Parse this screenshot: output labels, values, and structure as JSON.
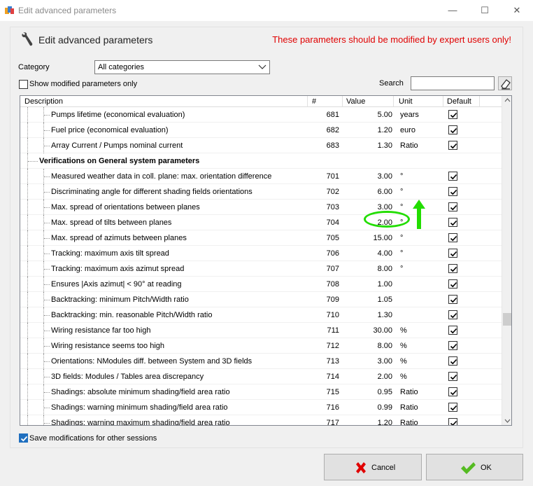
{
  "window": {
    "title": "Edit advanced parameters",
    "minimize_glyph": "—",
    "maximize_glyph": "☐",
    "close_glyph": "✕"
  },
  "header": {
    "title": "Edit advanced parameters",
    "warning": "These parameters should be modified by expert users only!",
    "warning_color": "#e00000",
    "icon": "wrench-icon"
  },
  "filters": {
    "category_label": "Category",
    "category_value": "All categories",
    "show_modified_label": "Show modified parameters only",
    "show_modified_checked": false,
    "search_label": "Search",
    "search_value": ""
  },
  "table": {
    "columns": [
      "Description",
      "#",
      "Value",
      "Unit",
      "Default"
    ],
    "rows": [
      {
        "type": "item",
        "desc": "Pumps lifetime (economical evaluation)",
        "num": "681",
        "value": "5.00",
        "unit": "years",
        "default": true
      },
      {
        "type": "item",
        "desc": "Fuel price (economical evaluation)",
        "num": "682",
        "value": "1.20",
        "unit": "euro",
        "default": true
      },
      {
        "type": "item",
        "desc": "Array Current / Pumps nominal current",
        "num": "683",
        "value": "1.30",
        "unit": "Ratio",
        "default": true
      },
      {
        "type": "group",
        "desc": "Verifications on General system parameters"
      },
      {
        "type": "item",
        "desc": "Measured weather data in coll. plane: max. orientation difference",
        "num": "701",
        "value": "3.00",
        "unit": "°",
        "default": true
      },
      {
        "type": "item",
        "desc": "Discriminating angle for different shading fields orientations",
        "num": "702",
        "value": "6.00",
        "unit": "°",
        "default": true
      },
      {
        "type": "item",
        "desc": "Max. spread of orientations between planes",
        "num": "703",
        "value": "3.00",
        "unit": "°",
        "default": true
      },
      {
        "type": "item",
        "desc": "Max. spread of tilts between planes",
        "num": "704",
        "value": "2.00",
        "unit": "°",
        "default": true
      },
      {
        "type": "item",
        "desc": "Max. spread of azimuts between planes",
        "num": "705",
        "value": "15.00",
        "unit": "°",
        "default": true
      },
      {
        "type": "item",
        "desc": "Tracking: maximum axis tilt spread",
        "num": "706",
        "value": "4.00",
        "unit": "°",
        "default": true
      },
      {
        "type": "item",
        "desc": "Tracking: maximum axis azimut spread",
        "num": "707",
        "value": "8.00",
        "unit": "°",
        "default": true
      },
      {
        "type": "item",
        "desc": "Ensures |Axis azimut| < 90° at reading",
        "num": "708",
        "value": "1.00",
        "unit": "",
        "default": true
      },
      {
        "type": "item",
        "desc": "Backtracking: minimum Pitch/Width ratio",
        "num": "709",
        "value": "1.05",
        "unit": "",
        "default": true
      },
      {
        "type": "item",
        "desc": "Backtracking: min. reasonable Pitch/Width ratio",
        "num": "710",
        "value": "1.30",
        "unit": "",
        "default": true
      },
      {
        "type": "item",
        "desc": "Wiring resistance far too high",
        "num": "711",
        "value": "30.00",
        "unit": "%",
        "default": true
      },
      {
        "type": "item",
        "desc": "Wiring resistance seems too high",
        "num": "712",
        "value": "8.00",
        "unit": "%",
        "default": true
      },
      {
        "type": "item",
        "desc": "Orientations: NModules diff. between System and 3D fields",
        "num": "713",
        "value": "3.00",
        "unit": "%",
        "default": true
      },
      {
        "type": "item",
        "desc": "3D fields: Modules / Tables area discrepancy",
        "num": "714",
        "value": "2.00",
        "unit": "%",
        "default": true
      },
      {
        "type": "item",
        "desc": "Shadings: absolute minimum shading/field area ratio",
        "num": "715",
        "value": "0.95",
        "unit": "Ratio",
        "default": true
      },
      {
        "type": "item",
        "desc": "Shadings: warning minimum shading/field area ratio",
        "num": "716",
        "value": "0.99",
        "unit": "Ratio",
        "default": true
      },
      {
        "type": "item",
        "desc": "Shadings: warning maximum shading/field area ratio",
        "num": "717",
        "value": "1.20",
        "unit": "Ratio",
        "default": true
      }
    ]
  },
  "footer": {
    "save_sessions_label": "Save modifications for other sessions",
    "save_sessions_checked": true,
    "cancel_label": "Cancel",
    "ok_label": "OK",
    "cancel_icon_color": "#e00000",
    "ok_icon_color": "#55bb22"
  },
  "annotation": {
    "highlight_color": "#22dd00"
  }
}
